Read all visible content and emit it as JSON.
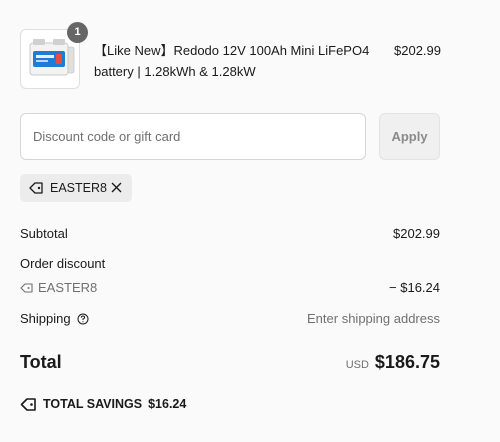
{
  "product": {
    "quantity": "1",
    "title": "【Like New】Redodo 12V 100Ah Mini LiFePO4 battery | 1.28kWh & 1.28kW",
    "price": "$202.99",
    "image_icon": "battery-product-icon"
  },
  "discount": {
    "placeholder": "Discount code or gift card",
    "apply_label": "Apply"
  },
  "applied_code": {
    "code": "EASTER8",
    "tag_icon": "tag-icon",
    "remove_icon": "close-icon"
  },
  "summary": {
    "subtotal_label": "Subtotal",
    "subtotal_value": "$202.99",
    "order_discount_label": "Order discount",
    "discount_code": "EASTER8",
    "discount_value": "− $16.24",
    "shipping_label": "Shipping",
    "shipping_value": "Enter shipping address",
    "total_label": "Total",
    "currency": "USD",
    "total_value": "$186.75",
    "savings_label": "TOTAL SAVINGS",
    "savings_value": "$16.24"
  },
  "colors": {
    "text": "#1a1a1a",
    "muted": "#707070",
    "chip_bg": "#ececec",
    "battery_blue": "#1e7bd6"
  }
}
